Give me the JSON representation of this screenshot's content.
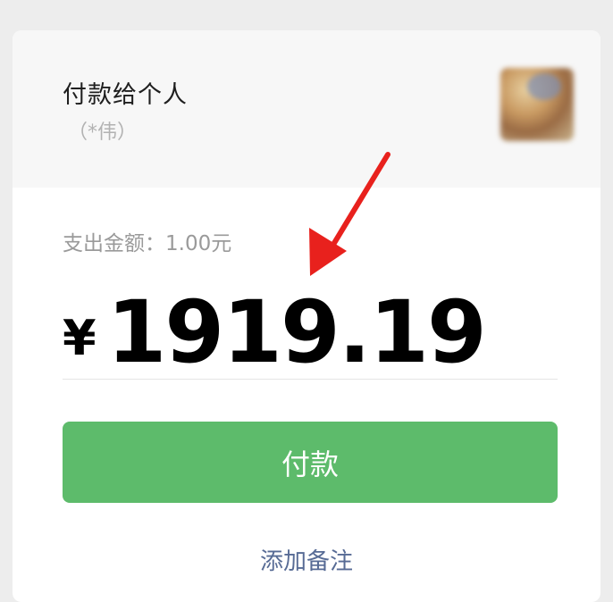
{
  "payee": {
    "title": "付款给个人",
    "name": "（*伟）"
  },
  "expense": {
    "label": "支出金额：",
    "value": "1.00元"
  },
  "amount": {
    "currency": "¥",
    "value": "1919.19"
  },
  "actions": {
    "pay_label": "付款",
    "add_note_label": "添加备注"
  },
  "colors": {
    "pay_button": "#5dbb6b",
    "add_note_link": "#576b95",
    "annotation_arrow": "#e8211d"
  },
  "icons": {
    "annotation": "red-arrow-icon"
  }
}
